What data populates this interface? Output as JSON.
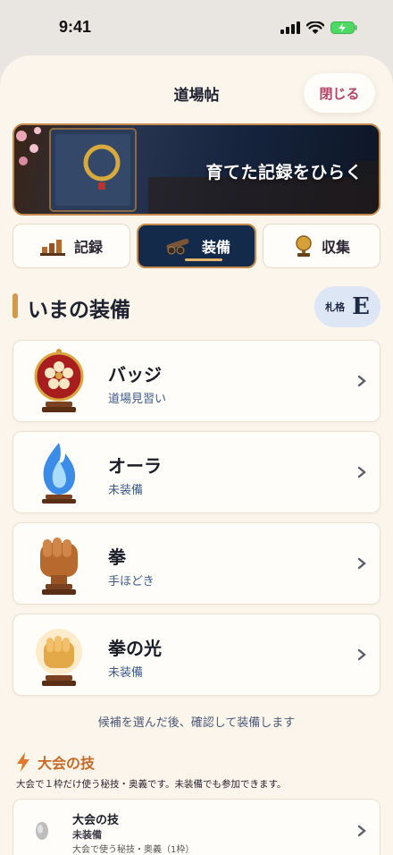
{
  "status": {
    "time": "9:41"
  },
  "header": {
    "title": "道場帖",
    "close_label": "閉じる"
  },
  "banner": {
    "text": "育てた記録をひらく"
  },
  "tabs": [
    {
      "label": "記録",
      "icon": "bar-chart-icon",
      "active": false
    },
    {
      "label": "装備",
      "icon": "cannon-icon",
      "active": true
    },
    {
      "label": "収集",
      "icon": "trophy-icon",
      "active": false
    }
  ],
  "equipment": {
    "heading": "いまの装備",
    "rank_label": "札格",
    "rank_value": "E",
    "items": [
      {
        "title": "バッジ",
        "subtitle": "道場見習い",
        "icon": "sakura-badge-icon"
      },
      {
        "title": "オーラ",
        "subtitle": "未装備",
        "icon": "blue-flame-icon"
      },
      {
        "title": "拳",
        "subtitle": "手ほどき",
        "icon": "fist-icon"
      },
      {
        "title": "拳の光",
        "subtitle": "未装備",
        "icon": "glowing-fist-icon"
      }
    ],
    "hint": "候補を選んだ後、確認して装備します"
  },
  "technique": {
    "heading": "大会の技",
    "icon": "lightning-icon",
    "description": "大会で１枠だけ使う秘技・奥義です。未装備でも参加できます。",
    "card": {
      "name": "大会の技",
      "status": "未装備",
      "note": "大会で使う秘技・奥義（1枠）"
    }
  },
  "colors": {
    "accent": "#b3436a",
    "navy": "#132a4a",
    "gold": "#c48a4e",
    "orange": "#c86a24"
  }
}
